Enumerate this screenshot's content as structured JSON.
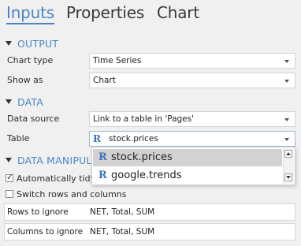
{
  "tabs": [
    {
      "label": "Inputs",
      "active": true
    },
    {
      "label": "Properties",
      "active": false
    },
    {
      "label": "Chart",
      "active": false
    }
  ],
  "sections": {
    "output": "OUTPUT",
    "data": "DATA",
    "data_manipulation": "DATA MANIPUL"
  },
  "fields": {
    "chart_type": {
      "label": "Chart type",
      "value": "Time Series"
    },
    "show_as": {
      "label": "Show as",
      "value": "Chart"
    },
    "data_source": {
      "label": "Data source",
      "value": "Link to a table in 'Pages'"
    },
    "table": {
      "label": "Table",
      "value": "stock.prices"
    }
  },
  "dropdown": {
    "options": [
      {
        "label": "stock.prices",
        "selected": true
      },
      {
        "label": "google.trends",
        "selected": false
      }
    ]
  },
  "badge_r": "R",
  "checkboxes": {
    "auto_tidy": {
      "label": "Automatically tidy",
      "checked": true
    },
    "switch_rows": {
      "label": "Switch rows and columns",
      "checked": false
    }
  },
  "ignore": {
    "rows": {
      "label": "Rows to ignore",
      "value": "NET, Total, SUM"
    },
    "columns": {
      "label": "Columns to ignore",
      "value": "NET, Total, SUM"
    }
  },
  "colors": {
    "accent": "#4a86c5",
    "background": "#f0f0f0",
    "selected_option": "#d2d2d2"
  }
}
